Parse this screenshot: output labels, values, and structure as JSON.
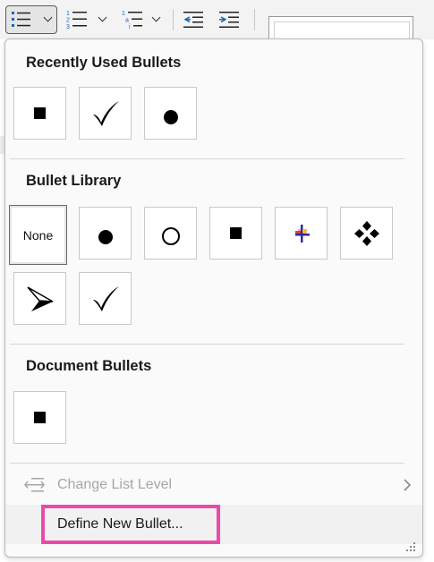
{
  "ribbon": {
    "buttons": [
      {
        "name": "bullets-split-button",
        "icon": "bulleted-list-icon"
      },
      {
        "name": "numbering-split-button",
        "icon": "numbered-list-icon"
      },
      {
        "name": "multilevel-list-split-button",
        "icon": "multilevel-list-icon"
      },
      {
        "name": "decrease-indent-button",
        "icon": "decrease-indent-icon"
      },
      {
        "name": "increase-indent-button",
        "icon": "increase-indent-icon"
      }
    ]
  },
  "dropdown": {
    "recently_used": {
      "title": "Recently Used Bullets",
      "items": [
        "black-square-bullet",
        "checkmark-bullet",
        "black-circle-bullet"
      ]
    },
    "library": {
      "title": "Bullet Library",
      "none_label": "None",
      "items": [
        "none",
        "black-circle-bullet",
        "hollow-circle-bullet",
        "black-square-bullet",
        "colorful-square-bullet",
        "four-diamond-bullet",
        "arrowhead-bullet",
        "checkmark-bullet"
      ]
    },
    "document": {
      "title": "Document Bullets",
      "items": [
        "black-square-bullet"
      ]
    },
    "change_list_level": {
      "label": "Change List Level",
      "icon": "change-level-icon",
      "submenu_icon": "chevron-right-icon"
    },
    "define_new_bullet": {
      "label": "Define New Bullet..."
    }
  },
  "colors": {
    "highlight_box": "#ea4aa8",
    "ribbon_accent": "#1565c0",
    "disabled_text": "#a6a6a6"
  }
}
